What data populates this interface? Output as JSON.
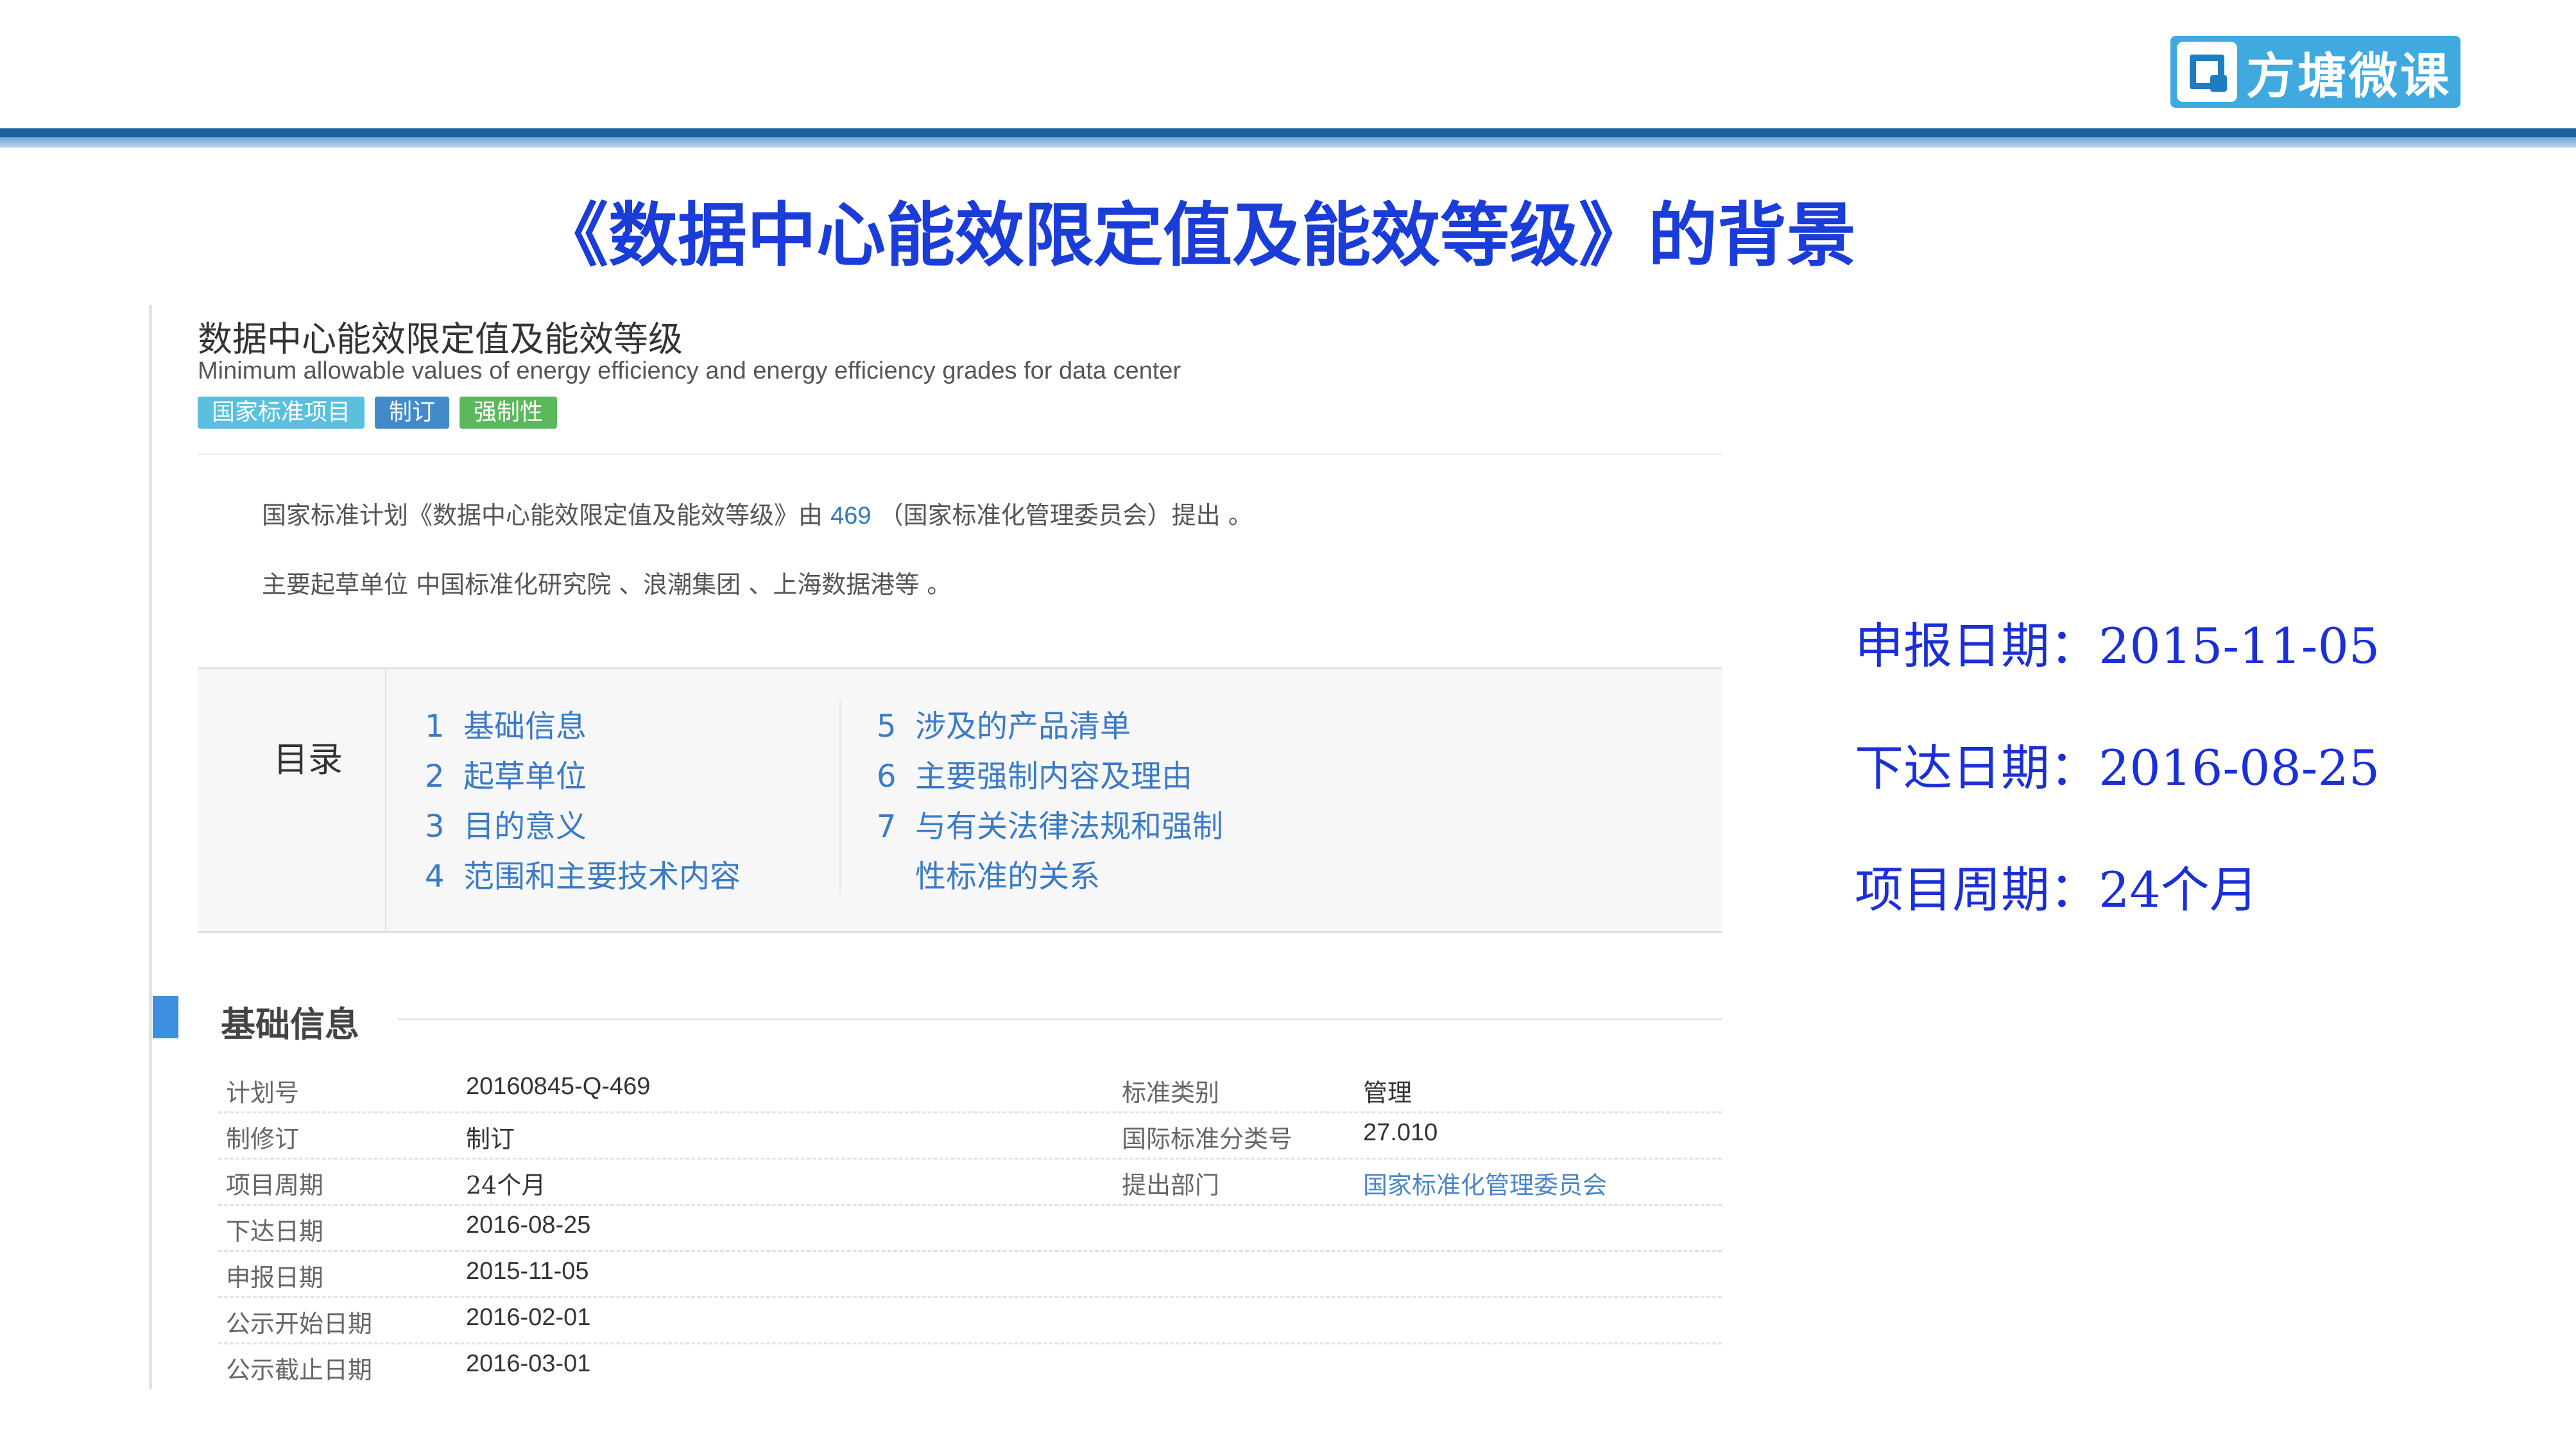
{
  "logo": {
    "text": "方塘微课"
  },
  "slide_title": "《数据中心能效限定值及能效等级》的背景",
  "doc": {
    "title": "数据中心能效限定值及能效等级",
    "subtitle": "Minimum allowable values of energy efficiency and energy efficiency grades for data center",
    "tags": [
      "国家标准项目",
      "制订",
      "强制性"
    ],
    "desc1_pre": "国家标准计划《数据中心能效限定值及能效等级》由",
    "desc1_link": "469",
    "desc1_post": "（国家标准化管理委员会）提出 。",
    "desc2": "主要起草单位 中国标准化研究院 、浪潮集团 、上海数据港等 。"
  },
  "toc": {
    "label": "目录",
    "items": [
      {
        "num": "1",
        "text": "基础信息"
      },
      {
        "num": "2",
        "text": "起草单位"
      },
      {
        "num": "3",
        "text": "目的意义"
      },
      {
        "num": "4",
        "text": "范围和主要技术内容"
      },
      {
        "num": "5",
        "text": "涉及的产品清单"
      },
      {
        "num": "6",
        "text": "主要强制内容及理由"
      },
      {
        "num": "7",
        "text": "与有关法律法规和强制"
      },
      {
        "num": "",
        "text": "性标准的关系"
      }
    ]
  },
  "basic_info": {
    "title": "基础信息",
    "rows": [
      {
        "label": "计划号",
        "value": "20160845-Q-469",
        "label2": "标准类别",
        "value2": "管理"
      },
      {
        "label": "制修订",
        "value": "制订",
        "label2": "国际标准分类号",
        "value2": "27.010"
      },
      {
        "label": "项目周期",
        "value": "24个月",
        "label2": "提出部门",
        "value2": "国家标准化管理委员会"
      },
      {
        "label": "下达日期",
        "value": "2016-08-25"
      },
      {
        "label": "申报日期",
        "value": "2015-11-05"
      },
      {
        "label": "公示开始日期",
        "value": "2016-02-01"
      },
      {
        "label": "公示截止日期",
        "value": "2016-03-01"
      }
    ]
  },
  "side_notes": {
    "report_date": "申报日期：2015-11-05",
    "issue_date": "下达日期：2016-08-25",
    "cycle": "项目周期：24个月"
  },
  "colors": {
    "title_blue": "#1a3cd8",
    "header_bar": "#1d5f9e",
    "toc_link": "#3a7bc8",
    "tag_1": "#5bc0de",
    "tag_2": "#428bca",
    "tag_3": "#5cb85c"
  }
}
